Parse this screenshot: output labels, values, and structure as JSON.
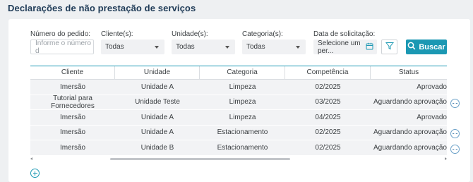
{
  "page": {
    "title": "Declarações de não prestação de serviços"
  },
  "filters": {
    "order_number": {
      "label": "Número do pedido:",
      "placeholder": "Informe o número d"
    },
    "client": {
      "label": "Cliente(s):",
      "value": "Todas"
    },
    "unit": {
      "label": "Unidade(s):",
      "value": "Todas"
    },
    "category": {
      "label": "Categoria(s):",
      "value": "Todas"
    },
    "request_date": {
      "label": "Data de solicitação:",
      "placeholder": "Selecione um per..."
    },
    "filter_icon": "filter-icon",
    "search_button": {
      "label": "Buscar",
      "icon": "search-icon"
    }
  },
  "table": {
    "columns": [
      "Cliente",
      "Unidade",
      "Categoria",
      "Competência",
      "Status"
    ],
    "rows": [
      {
        "client": "Imersão",
        "unit": "Unidade A",
        "category": "Limpeza",
        "period": "02/2025",
        "status": "Aprovado",
        "has_actions": false
      },
      {
        "client": "Tutorial para Fornecedores",
        "unit": "Unidade Teste",
        "category": "Limpeza",
        "period": "03/2025",
        "status": "Aguardando aprovação",
        "has_actions": true
      },
      {
        "client": "Imersão",
        "unit": "Unidade A",
        "category": "Limpeza",
        "period": "04/2025",
        "status": "Aprovado",
        "has_actions": false
      },
      {
        "client": "Imersão",
        "unit": "Unidade A",
        "category": "Estacionamento",
        "period": "02/2025",
        "status": "Aguardando aprovação",
        "has_actions": true
      },
      {
        "client": "Imersão",
        "unit": "Unidade B",
        "category": "Estacionamento",
        "period": "02/2025",
        "status": "Aguardando aprovação",
        "has_actions": true
      }
    ]
  },
  "colors": {
    "accent": "#1b98b3",
    "title": "#1f3b57",
    "row_alt": "#f2f3f5"
  }
}
